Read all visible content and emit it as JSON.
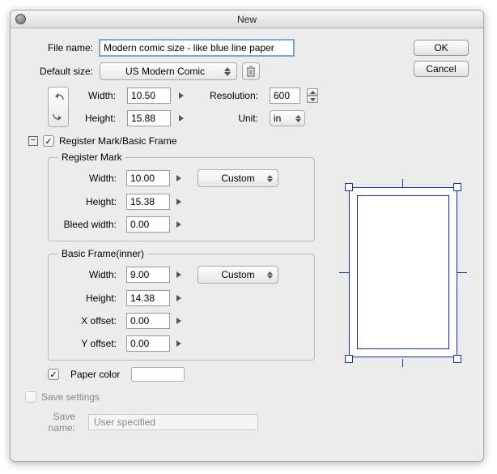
{
  "window": {
    "title": "New"
  },
  "buttons": {
    "ok": "OK",
    "cancel": "Cancel"
  },
  "file": {
    "label": "File name:",
    "value": "Modern comic size - like blue line paper"
  },
  "default_size": {
    "label": "Default size:",
    "value": "US Modern Comic"
  },
  "dims": {
    "width_label": "Width:",
    "width": "10.50",
    "height_label": "Height:",
    "height": "15.88",
    "res_label": "Resolution:",
    "res": "600",
    "unit_label": "Unit:",
    "unit": "in"
  },
  "register_section": {
    "label": "Register Mark/Basic Frame"
  },
  "register_mark": {
    "legend": "Register Mark",
    "width_label": "Width:",
    "width": "10.00",
    "height_label": "Height:",
    "height": "15.38",
    "bleed_label": "Bleed width:",
    "bleed": "0.00",
    "preset": "Custom"
  },
  "basic_frame": {
    "legend": "Basic Frame(inner)",
    "width_label": "Width:",
    "width": "9.00",
    "height_label": "Height:",
    "height": "14.38",
    "xoff_label": "X offset:",
    "xoff": "0.00",
    "yoff_label": "Y offset:",
    "yoff": "0.00",
    "preset": "Custom"
  },
  "paper": {
    "label": "Paper color"
  },
  "save": {
    "label": "Save settings",
    "name_label": "Save name:",
    "name": "User specified"
  }
}
